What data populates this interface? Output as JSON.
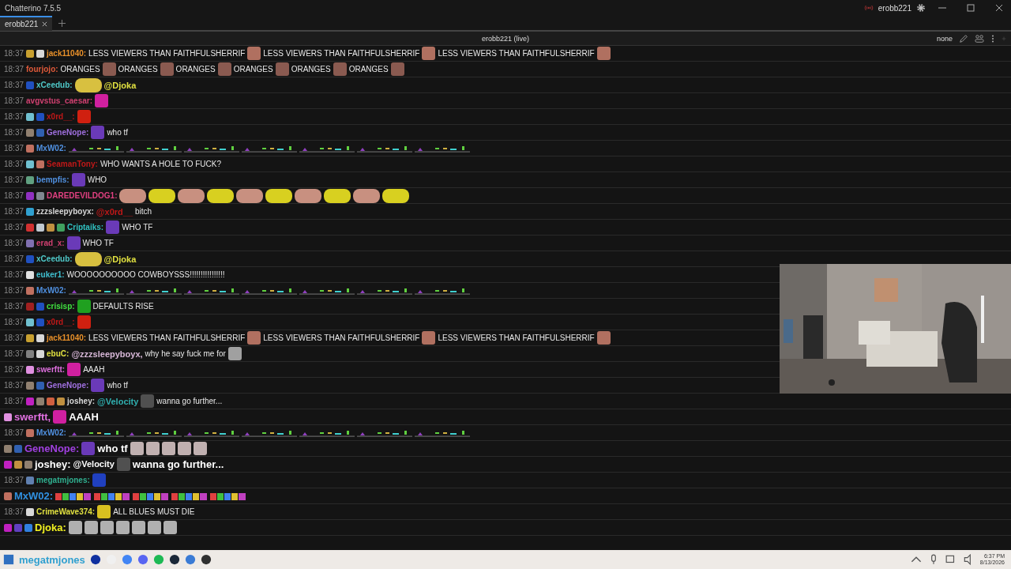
{
  "window": {
    "title": "Chatterino 7.5.5",
    "account": "erobb221"
  },
  "tabs": [
    {
      "label": "erobb221",
      "selected": true
    }
  ],
  "channel_header": {
    "title": "erobb221 (live)",
    "mode": "none"
  },
  "chat": {
    "messages": [
      {
        "kind": "normal",
        "time": "18:37",
        "badges": [
          {
            "color": "#c8a030"
          },
          {
            "color": "#d8d8d8"
          }
        ],
        "user": "jack11040:",
        "color": "#e8902a",
        "parts": [
          {
            "kind": "text",
            "text": "LESS VIEWERS THAN FAITHFULSHERRIF"
          },
          {
            "kind": "emote",
            "color": "#b07060"
          },
          {
            "kind": "text",
            "text": "LESS VIEWERS THAN FAITHFULSHERRIF"
          },
          {
            "kind": "emote",
            "color": "#b07060"
          },
          {
            "kind": "text",
            "text": "LESS VIEWERS THAN FAITHFULSHERRIF"
          },
          {
            "kind": "emote",
            "color": "#b07060"
          }
        ]
      },
      {
        "kind": "normal",
        "time": "18:37",
        "user": "fourjojo:",
        "color": "#e05a3a",
        "parts": [
          {
            "kind": "text",
            "text": "ORANGES"
          },
          {
            "kind": "emote",
            "color": "#8a5a50"
          },
          {
            "kind": "text",
            "text": "ORANGES"
          },
          {
            "kind": "emote",
            "color": "#8a5a50"
          },
          {
            "kind": "text",
            "text": "ORANGES"
          },
          {
            "kind": "emote",
            "color": "#8a5a50"
          },
          {
            "kind": "text",
            "text": "ORANGES"
          },
          {
            "kind": "emote",
            "color": "#8a5a50"
          },
          {
            "kind": "text",
            "text": "ORANGES"
          },
          {
            "kind": "emote",
            "color": "#8a5a50"
          },
          {
            "kind": "text",
            "text": "ORANGES"
          },
          {
            "kind": "emote",
            "color": "#8a5a50"
          }
        ]
      },
      {
        "kind": "normal",
        "time": "18:37",
        "badges": [
          {
            "color": "#2050c0"
          }
        ],
        "user": "xCeedub:",
        "color": "#4fc8c8",
        "parts": [
          {
            "kind": "wide-emote",
            "color": "#d8c040"
          },
          {
            "kind": "mention",
            "text": "@Djoka",
            "color": "#e0e040"
          }
        ]
      },
      {
        "kind": "normal",
        "time": "18:37",
        "user": "avgvstus_caesar:",
        "color": "#d04070",
        "parts": [
          {
            "kind": "emote",
            "color": "#d020a0"
          }
        ]
      },
      {
        "kind": "normal",
        "time": "18:37",
        "badges": [
          {
            "color": "#70c0d0"
          },
          {
            "color": "#2050c0"
          }
        ],
        "user": "x0rd__:",
        "color": "#c01818",
        "parts": [
          {
            "kind": "emote",
            "color": "#d02010"
          }
        ]
      },
      {
        "kind": "normal",
        "time": "18:37",
        "badges": [
          {
            "color": "#908070"
          },
          {
            "color": "#3060b0"
          }
        ],
        "user": "GeneNope:",
        "color": "#a070e0",
        "parts": [
          {
            "kind": "emote",
            "color": "#6a3ab8"
          },
          {
            "kind": "text",
            "text": "who tf"
          }
        ]
      },
      {
        "kind": "normal",
        "time": "18:37",
        "badges": [
          {
            "color": "#c07060"
          }
        ],
        "user": "MxW02:",
        "color": "#5090e0",
        "parts": [
          {
            "kind": "strip"
          },
          {
            "kind": "strip"
          },
          {
            "kind": "strip"
          },
          {
            "kind": "strip"
          },
          {
            "kind": "strip"
          },
          {
            "kind": "strip"
          },
          {
            "kind": "strip"
          }
        ]
      },
      {
        "kind": "normal",
        "time": "18:37",
        "badges": [
          {
            "color": "#70c0d0"
          },
          {
            "color": "#c07060"
          }
        ],
        "user": "SeamanTony:",
        "color": "#c01818",
        "parts": [
          {
            "kind": "text",
            "text": "WHO WANTS A HOLE TO FUCK?"
          }
        ]
      },
      {
        "kind": "normal",
        "time": "18:37",
        "badges": [
          {
            "color": "#60a080"
          }
        ],
        "user": "bempfis:",
        "color": "#5090e0",
        "parts": [
          {
            "kind": "emote",
            "color": "#6a3ab8"
          },
          {
            "kind": "text",
            "text": "WHO"
          }
        ]
      },
      {
        "kind": "normal",
        "time": "18:37",
        "badges": [
          {
            "color": "#9030c0"
          },
          {
            "color": "#808890"
          }
        ],
        "user": "DAREDEVILDOG1:",
        "color": "#e04080",
        "parts": [
          {
            "kind": "wide-emote",
            "color": "#c89080"
          },
          {
            "kind": "wide-emote",
            "color": "#d8d020"
          },
          {
            "kind": "wide-emote",
            "color": "#c89080"
          },
          {
            "kind": "wide-emote",
            "color": "#d8d020"
          },
          {
            "kind": "wide-emote",
            "color": "#c89080"
          },
          {
            "kind": "wide-emote",
            "color": "#d8d020"
          },
          {
            "kind": "wide-emote",
            "color": "#c89080"
          },
          {
            "kind": "wide-emote",
            "color": "#d8d020"
          },
          {
            "kind": "wide-emote",
            "color": "#c89080"
          },
          {
            "kind": "wide-emote",
            "color": "#d8d020"
          }
        ]
      },
      {
        "kind": "normal",
        "time": "18:37",
        "badges": [
          {
            "color": "#30a0d0"
          }
        ],
        "user": "zzzsleepyboyx:",
        "color": "#d8d8d8",
        "parts": [
          {
            "kind": "mention",
            "text": "@x0rd__",
            "color": "#c01818"
          },
          {
            "kind": "text",
            "text": "bitch"
          }
        ]
      },
      {
        "kind": "normal",
        "time": "18:37",
        "badges": [
          {
            "color": "#d03030"
          },
          {
            "color": "#c0c8d0"
          },
          {
            "color": "#c09040"
          },
          {
            "color": "#40a060"
          }
        ],
        "user": "Criptaiks:",
        "color": "#30c0c0",
        "parts": [
          {
            "kind": "emote",
            "color": "#6a3ab8"
          },
          {
            "kind": "text",
            "text": "WHO TF"
          }
        ]
      },
      {
        "kind": "normal",
        "time": "18:37",
        "badges": [
          {
            "color": "#8070b0"
          }
        ],
        "user": "erad_x:",
        "color": "#d04070",
        "parts": [
          {
            "kind": "emote",
            "color": "#6a3ab8"
          },
          {
            "kind": "text",
            "text": "WHO TF"
          }
        ]
      },
      {
        "kind": "normal",
        "time": "18:37",
        "badges": [
          {
            "color": "#2050c0"
          }
        ],
        "user": "xCeedub:",
        "color": "#4fc8c8",
        "parts": [
          {
            "kind": "wide-emote",
            "color": "#d8c040"
          },
          {
            "kind": "mention",
            "text": "@Djoka",
            "color": "#e0e040"
          }
        ]
      },
      {
        "kind": "normal",
        "time": "18:37",
        "badges": [
          {
            "color": "#e0e0e0"
          }
        ],
        "user": "euker1:",
        "color": "#40c0d0",
        "parts": [
          {
            "kind": "text",
            "text": "WOOOOOOOOOO COWBOYSSS!!!!!!!!!!!!!!!!"
          }
        ]
      },
      {
        "kind": "normal",
        "time": "18:37",
        "badges": [
          {
            "color": "#c07060"
          }
        ],
        "user": "MxW02:",
        "color": "#5090e0",
        "parts": [
          {
            "kind": "strip"
          },
          {
            "kind": "strip"
          },
          {
            "kind": "strip"
          },
          {
            "kind": "strip"
          },
          {
            "kind": "strip"
          },
          {
            "kind": "strip"
          },
          {
            "kind": "strip"
          }
        ]
      },
      {
        "kind": "normal",
        "time": "18:37",
        "badges": [
          {
            "color": "#a02020"
          },
          {
            "color": "#2050c0"
          }
        ],
        "user": "crisisp:",
        "color": "#40e040",
        "parts": [
          {
            "kind": "emote",
            "color": "#20a020"
          },
          {
            "kind": "text",
            "text": "DEFAULTS RISE"
          }
        ]
      },
      {
        "kind": "normal",
        "time": "18:37",
        "badges": [
          {
            "color": "#70c0d0"
          },
          {
            "color": "#2050c0"
          }
        ],
        "user": "x0rd__:",
        "color": "#c01818",
        "parts": [
          {
            "kind": "emote",
            "color": "#d02010"
          }
        ]
      },
      {
        "kind": "normal",
        "time": "18:37",
        "badges": [
          {
            "color": "#c8a030"
          },
          {
            "color": "#d8d8d8"
          }
        ],
        "user": "jack11040:",
        "color": "#e8902a",
        "parts": [
          {
            "kind": "text",
            "text": "LESS VIEWERS THAN FAITHFULSHERRIF"
          },
          {
            "kind": "emote",
            "color": "#b07060"
          },
          {
            "kind": "text",
            "text": "LESS VIEWERS THAN FAITHFULSHERRIF"
          },
          {
            "kind": "emote",
            "color": "#b07060"
          },
          {
            "kind": "text",
            "text": "LESS VIEWERS THAN FAITHFULSHERRIF"
          },
          {
            "kind": "emote",
            "color": "#b07060"
          }
        ]
      },
      {
        "kind": "normal",
        "time": "18:37",
        "badges": [
          {
            "color": "#808080"
          },
          {
            "color": "#d8d8d8"
          }
        ],
        "user": "ebuC:",
        "color": "#e0e040",
        "parts": [
          {
            "kind": "mention",
            "text": "@zzzsleepyboyx,",
            "color": "#d8b8d8"
          },
          {
            "kind": "text",
            "text": "why he say fuck me for"
          },
          {
            "kind": "emote",
            "color": "#a0a0a0"
          }
        ]
      },
      {
        "kind": "normal",
        "time": "18:37",
        "badges": [
          {
            "color": "#e090e0"
          }
        ],
        "user": "swerftt:",
        "color": "#e070e0",
        "parts": [
          {
            "kind": "emote",
            "color": "#d020a0"
          },
          {
            "kind": "text",
            "text": "AAAH"
          }
        ]
      },
      {
        "kind": "normal",
        "time": "18:37",
        "badges": [
          {
            "color": "#908070"
          },
          {
            "color": "#3060b0"
          }
        ],
        "user": "GeneNope:",
        "color": "#a070e0",
        "parts": [
          {
            "kind": "emote",
            "color": "#6a3ab8"
          },
          {
            "kind": "text",
            "text": "who tf"
          }
        ]
      },
      {
        "kind": "normal",
        "time": "18:37",
        "badges": [
          {
            "color": "#c020c0"
          },
          {
            "color": "#908070"
          },
          {
            "color": "#d06040"
          },
          {
            "color": "#c09040"
          }
        ],
        "user": "joshey:",
        "color": "#d8d8d8",
        "parts": [
          {
            "kind": "mention",
            "text": "@Velocity",
            "color": "#30b0b0"
          },
          {
            "kind": "emote",
            "color": "#505050"
          },
          {
            "kind": "text",
            "text": "wanna go further..."
          }
        ]
      },
      {
        "kind": "overlay",
        "badges": [
          {
            "color": "#e090e0"
          }
        ],
        "user": "swerftt,",
        "color": "#e070e0",
        "parts": [
          {
            "kind": "emote",
            "color": "#d020a0"
          },
          {
            "kind": "text",
            "text": "AAAH"
          }
        ]
      },
      {
        "kind": "normal",
        "time": "18:37",
        "badges": [
          {
            "color": "#c07060"
          }
        ],
        "user": "MxW02:",
        "color": "#5090e0",
        "parts": [
          {
            "kind": "strip"
          },
          {
            "kind": "strip"
          },
          {
            "kind": "strip"
          },
          {
            "kind": "strip"
          },
          {
            "kind": "strip"
          },
          {
            "kind": "strip"
          },
          {
            "kind": "strip"
          }
        ]
      },
      {
        "kind": "overlay",
        "badges": [
          {
            "color": "#908070"
          },
          {
            "color": "#3060b0"
          }
        ],
        "user": "GeneNope:",
        "color": "#a040e0",
        "parts": [
          {
            "kind": "emote",
            "color": "#6a3ab8"
          },
          {
            "kind": "text",
            "text": "who tf"
          },
          {
            "kind": "emote",
            "color": "#c0b0b0"
          },
          {
            "kind": "emote",
            "color": "#c0b0b0"
          },
          {
            "kind": "emote",
            "color": "#c0b0b0"
          },
          {
            "kind": "emote",
            "color": "#c0b0b0"
          },
          {
            "kind": "emote",
            "color": "#c0b0b0"
          }
        ]
      },
      {
        "kind": "overlay",
        "badges": [
          {
            "color": "#c020c0"
          },
          {
            "color": "#c09040"
          },
          {
            "color": "#908070"
          }
        ],
        "user": "joshey:",
        "color": "#ffffff",
        "parts": [
          {
            "kind": "mention",
            "text": "@Velocity",
            "color": "#ffffff"
          },
          {
            "kind": "emote",
            "color": "#505050"
          },
          {
            "kind": "text",
            "text": "wanna go further..."
          }
        ]
      },
      {
        "kind": "normal",
        "time": "18:37",
        "badges": [
          {
            "color": "#6080b0"
          }
        ],
        "user": "megatmjones:",
        "color": "#30b090",
        "parts": [
          {
            "kind": "emote",
            "color": "#2040c0"
          }
        ]
      },
      {
        "kind": "overlay",
        "badges": [
          {
            "color": "#c07060"
          }
        ],
        "user": "MxW02:",
        "color": "#3090e0",
        "parts": [
          {
            "kind": "loser"
          },
          {
            "kind": "loser"
          },
          {
            "kind": "loser"
          },
          {
            "kind": "loser"
          },
          {
            "kind": "loser"
          }
        ]
      },
      {
        "kind": "normal",
        "time": "18:37",
        "badges": [
          {
            "color": "#d8d8d8"
          }
        ],
        "user": "CrimeWave374:",
        "color": "#e0e040",
        "parts": [
          {
            "kind": "emote",
            "color": "#d8c020"
          },
          {
            "kind": "text",
            "text": "ALL BLUES MUST DIE"
          }
        ]
      },
      {
        "kind": "overlay",
        "badges": [
          {
            "color": "#c020c0"
          },
          {
            "color": "#6040c0"
          },
          {
            "color": "#3080e0"
          }
        ],
        "user": "Djoka:",
        "color": "#f0f020",
        "parts": [
          {
            "kind": "emote",
            "color": "#b0b0b0"
          },
          {
            "kind": "emote",
            "color": "#b0b0b0"
          },
          {
            "kind": "emote",
            "color": "#b0b0b0"
          },
          {
            "kind": "emote",
            "color": "#b0b0b0"
          },
          {
            "kind": "emote",
            "color": "#b0b0b0"
          },
          {
            "kind": "emote",
            "color": "#b0b0b0"
          },
          {
            "kind": "emote",
            "color": "#b0b0b0"
          }
        ]
      }
    ]
  },
  "taskbar": {
    "overlay_text": "megatmjones",
    "time": "6:37 PM",
    "date": "8/13/2026"
  }
}
